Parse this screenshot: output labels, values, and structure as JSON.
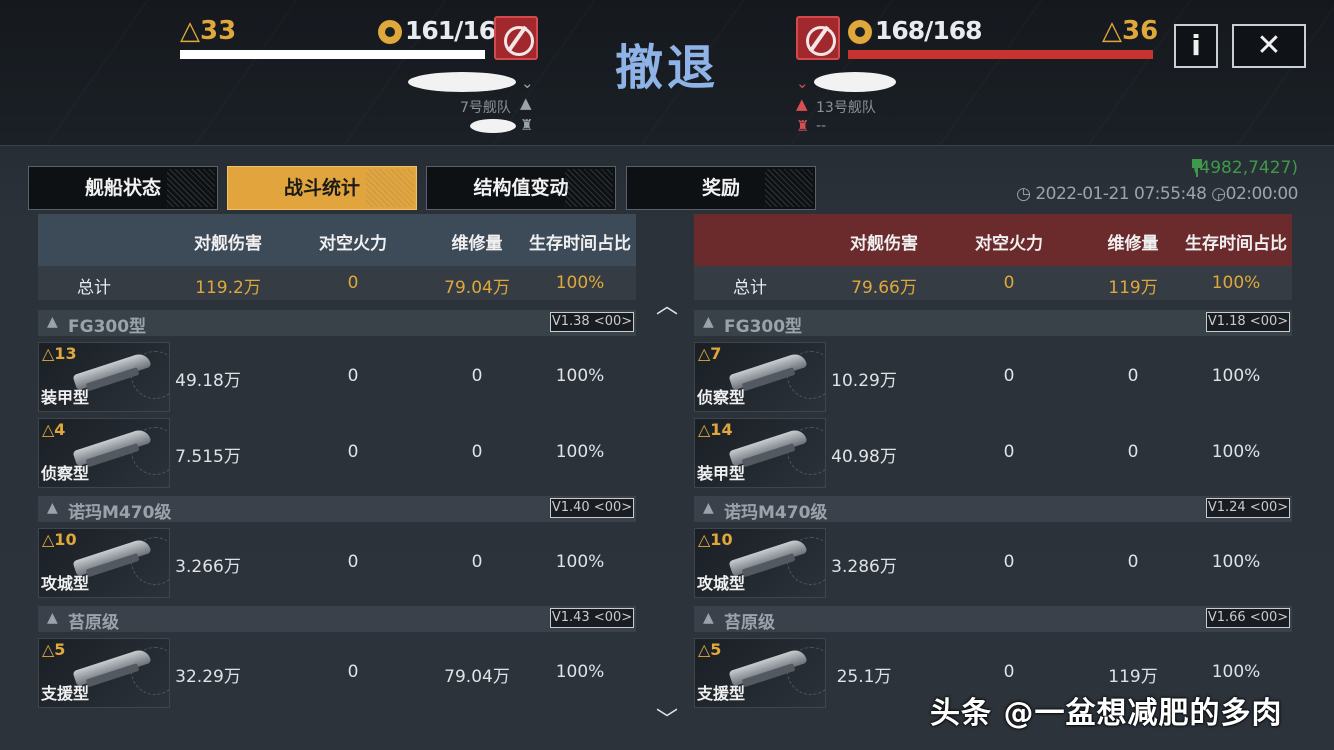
{
  "title": "撤退",
  "left_player": {
    "level": "△33",
    "hp": "161/161",
    "fleet": "7号舰队",
    "hp_bar_fraction": 1.0,
    "bar_color": "#ffffff"
  },
  "right_player": {
    "level": "△36",
    "hp": "168/168",
    "fleet": "13号舰队",
    "extra": "--",
    "hp_bar_fraction": 1.0,
    "bar_color": "#c8322f"
  },
  "buttons": {
    "info": "i",
    "close": "✕"
  },
  "tabs": [
    {
      "label": "舰船状态",
      "active": false
    },
    {
      "label": "战斗统计",
      "active": true
    },
    {
      "label": "结构值变动",
      "active": false
    },
    {
      "label": "奖励",
      "active": false
    }
  ],
  "coordinates": "(4982,7427)",
  "timestamp": "2022-01-21 07:55:48",
  "duration": "02:00:00",
  "columns": [
    "对舰伤害",
    "对空火力",
    "维修量",
    "生存时间占比"
  ],
  "total_label": "总计",
  "left_table": {
    "total": [
      "119.2万",
      "0",
      "79.04万",
      "100%"
    ],
    "groups": [
      {
        "name": "FG300型",
        "version": "V1.38 <00>",
        "ships": [
          {
            "level": "△13",
            "role": "装甲型",
            "values": [
              "49.18万",
              "0",
              "0",
              "100%"
            ]
          },
          {
            "level": "△4",
            "role": "侦察型",
            "values": [
              "7.515万",
              "0",
              "0",
              "100%"
            ]
          }
        ]
      },
      {
        "name": "诺玛M470级",
        "version": "V1.40 <00>",
        "ships": [
          {
            "level": "△10",
            "role": "攻城型",
            "values": [
              "3.266万",
              "0",
              "0",
              "100%"
            ]
          }
        ]
      },
      {
        "name": "苔原级",
        "version": "V1.43 <00>",
        "ships": [
          {
            "level": "△5",
            "role": "支援型",
            "values": [
              "32.29万",
              "0",
              "79.04万",
              "100%"
            ]
          }
        ]
      }
    ]
  },
  "right_table": {
    "total": [
      "79.66万",
      "0",
      "119万",
      "100%"
    ],
    "groups": [
      {
        "name": "FG300型",
        "version": "V1.18 <00>",
        "ships": [
          {
            "level": "△7",
            "role": "侦察型",
            "values": [
              "10.29万",
              "0",
              "0",
              "100%"
            ]
          },
          {
            "level": "△14",
            "role": "装甲型",
            "values": [
              "40.98万",
              "0",
              "0",
              "100%"
            ]
          }
        ]
      },
      {
        "name": "诺玛M470级",
        "version": "V1.24 <00>",
        "ships": [
          {
            "level": "△10",
            "role": "攻城型",
            "values": [
              "3.286万",
              "0",
              "0",
              "100%"
            ]
          }
        ]
      },
      {
        "name": "苔原级",
        "version": "V1.66 <00>",
        "ships": [
          {
            "level": "△5",
            "role": "支援型",
            "values": [
              "25.1万",
              "0",
              "119万",
              "100%"
            ]
          }
        ]
      }
    ]
  },
  "watermark": "头条 @一盆想减肥的多肉"
}
